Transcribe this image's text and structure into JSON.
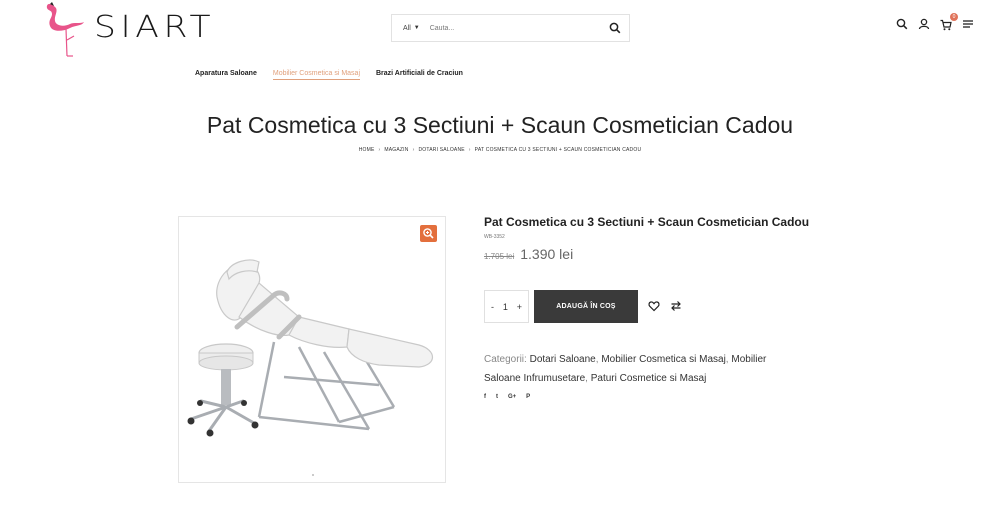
{
  "header": {
    "logo_text": "SIART",
    "search": {
      "category": "All",
      "placeholder": "Cauta..."
    },
    "cart_count": "0",
    "icons": [
      "search-icon",
      "user-icon",
      "cart-icon",
      "menu-icon"
    ]
  },
  "nav": {
    "items": [
      {
        "label": "Aparatura Saloane",
        "active": false
      },
      {
        "label": "Mobilier Cosmetica si Masaj",
        "active": true
      },
      {
        "label": "Brazi Artificiali de Craciun",
        "active": false
      }
    ]
  },
  "page": {
    "title": "Pat Cosmetica cu 3 Sectiuni + Scaun Cosmetician Cadou",
    "breadcrumb": [
      "HOME",
      "MAGAZIN",
      "DOTARI SALOANE",
      "PAT COSMETICA CU 3 SECTIUNI + SCAUN COSMETICIAN CADOU"
    ]
  },
  "product": {
    "name": "Pat Cosmetica cu 3 Sectiuni + Scaun Cosmetician Cadou",
    "sku": "WB-3352",
    "price_old": "1.705 lei",
    "price_new": "1.390 lei",
    "quantity": "1",
    "qty_minus": "-",
    "qty_plus": "+",
    "add_to_cart": "ADAUGĂ ÎN COȘ",
    "categories_label": "Categorii:",
    "categories": [
      "Dotari Saloane",
      "Mobilier Cosmetica si Masaj",
      "Mobilier Saloane Infrumusetare",
      "Paturi Cosmetice si Masaj"
    ],
    "shares": [
      "f",
      "t",
      "G+",
      "P"
    ]
  },
  "colors": {
    "accent": "#e36f3d",
    "nav_active": "#e0a07c",
    "button_dark": "#3a3a3a",
    "logo_pink": "#e8548a"
  }
}
